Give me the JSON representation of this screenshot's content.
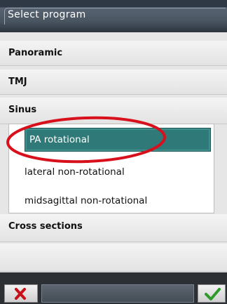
{
  "window": {
    "title": "Select program"
  },
  "categories": [
    {
      "label": "Panoramic"
    },
    {
      "label": "TMJ"
    },
    {
      "label": "Sinus"
    },
    {
      "label": "Cross sections"
    }
  ],
  "sinus_options": [
    {
      "label": "PA rotational",
      "selected": true
    },
    {
      "label": "lateral non-rotational",
      "selected": false
    },
    {
      "label": "midsagittal non-rotational",
      "selected": false
    }
  ],
  "bottom_bar": {
    "cancel_icon": "x-icon",
    "ok_icon": "checkmark-icon"
  },
  "colors": {
    "selected": "#2f7a78",
    "annotation": "#d8101c",
    "cancel": "#c8101a",
    "ok": "#2e9a2a"
  }
}
